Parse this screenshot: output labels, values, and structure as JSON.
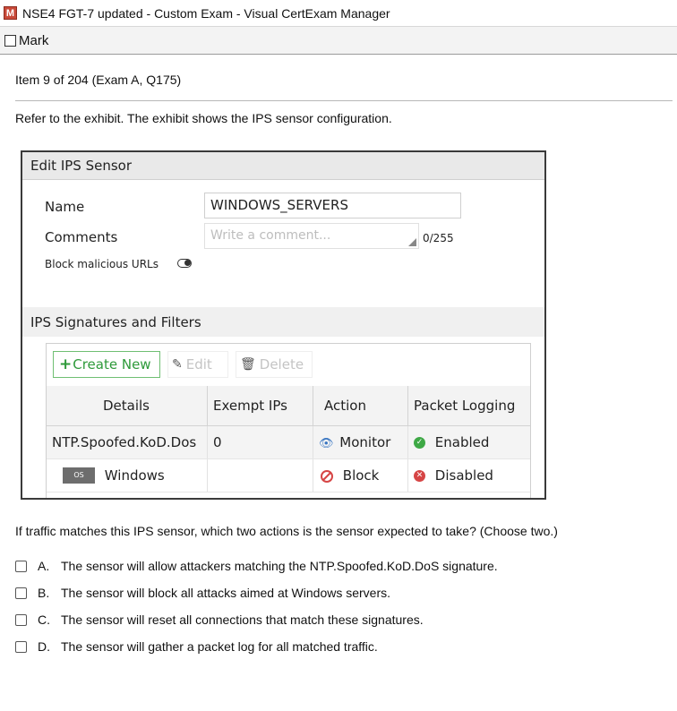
{
  "window": {
    "icon": "M",
    "title": "NSE4 FGT-7 updated - Custom Exam - Visual CertExam Manager"
  },
  "markbar": {
    "label": "Mark"
  },
  "item": {
    "text": "Item 9 of 204  (Exam A, Q175)"
  },
  "intro": "Refer to the exhibit. The exhibit shows the IPS sensor configuration.",
  "exhibit": {
    "header": "Edit IPS Sensor",
    "name_label": "Name",
    "name_value": "WINDOWS_SERVERS",
    "comments_label": "Comments",
    "comments_placeholder": "Write a comment...",
    "char_count": "0/255",
    "block_urls_label": "Block malicious URLs",
    "signatures_header": "IPS Signatures and Filters",
    "toolbar": {
      "create": "Create New",
      "edit": "Edit",
      "delete": "Delete"
    },
    "table": {
      "headers": [
        "Details",
        "Exempt IPs",
        "Action",
        "Packet Logging"
      ],
      "rows": [
        {
          "details": "NTP.Spoofed.KoD.Dos",
          "exempt": "0",
          "action": "Monitor",
          "logging": "Enabled"
        },
        {
          "os_badge": "OS",
          "details": "Windows",
          "exempt": "",
          "action": "Block",
          "logging": "Disabled"
        }
      ]
    }
  },
  "question": "If traffic matches this IPS sensor, which two actions is the sensor expected to take? (Choose two.)",
  "options": [
    {
      "letter": "A.",
      "text": "The sensor will allow attackers matching the NTP.Spoofed.KoD.DoS signature."
    },
    {
      "letter": "B.",
      "text": "The sensor will block all attacks aimed at Windows servers."
    },
    {
      "letter": "C.",
      "text": "The sensor will reset all connections that match these signatures."
    },
    {
      "letter": "D.",
      "text": "The sensor will gather a packet log for all matched traffic."
    }
  ],
  "colors": {
    "accent_green": "#2e9a3a",
    "status_red": "#d64545",
    "monitor_blue": "#3b77c2"
  }
}
